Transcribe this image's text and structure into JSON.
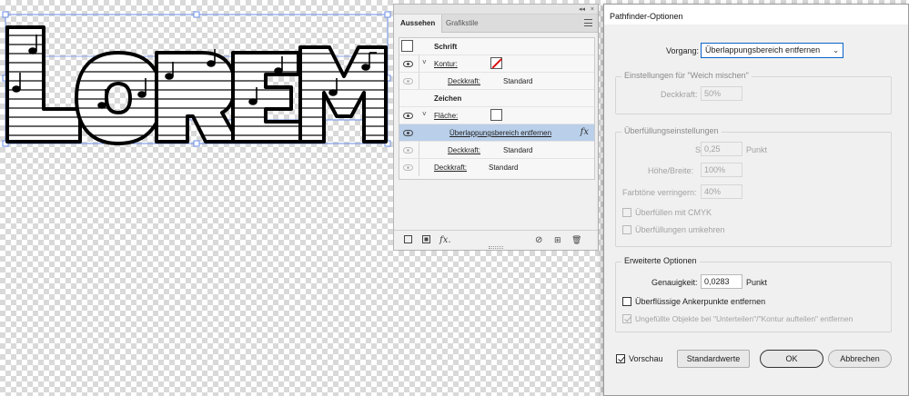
{
  "artwork": {
    "text": "LOREM"
  },
  "appearance_panel": {
    "collapse_icon": "◂◂",
    "close_icon": "×",
    "tabs": [
      {
        "label": "Aussehen",
        "active": true
      },
      {
        "label": "Grafikstile",
        "active": false
      }
    ],
    "rows": [
      {
        "label": "Schrift",
        "type": "header"
      },
      {
        "label": "Kontur:",
        "swatch": "none"
      },
      {
        "label": "Deckkraft:",
        "value": "Standard"
      },
      {
        "label": "Zeichen",
        "type": "header"
      },
      {
        "label": "Fläche:",
        "swatch": "white"
      },
      {
        "label": "Überlappungsbereich entfernen",
        "fx": "fx"
      },
      {
        "label": "Deckkraft:",
        "value": "Standard"
      },
      {
        "label": "Deckkraft:",
        "value": "Standard"
      }
    ],
    "footer_icons": [
      "new-stroke-icon",
      "new-fill-icon",
      "add-effect-icon",
      "clear-appearance-icon",
      "duplicate-item-icon",
      "delete-item-icon"
    ],
    "fx_label": "fx."
  },
  "dialog": {
    "title": "Pathfinder-Optionen",
    "operation_label": "Vorgang:",
    "operation_value": "Überlappungsbereich entfernen",
    "soft_mix": {
      "title": "Einstellungen für \"Weich mischen\"",
      "opacity_label": "Deckkraft:",
      "opacity_value": "50%"
    },
    "trapping": {
      "title": "Überfüllungseinstellungen",
      "strength_label": "Stärke:",
      "strength_value": "0,25",
      "strength_unit": "Punkt",
      "height_width_label": "Höhe/Breite:",
      "height_width_value": "100%",
      "tint_label": "Farbtöne verringern:",
      "tint_value": "40%",
      "cmyk_label": "Überfüllen mit CMYK",
      "reverse_label": "Überfüllungen umkehren"
    },
    "advanced": {
      "title": "Erweiterte Optionen",
      "precision_label": "Genauigkeit:",
      "precision_value": "0,0283",
      "precision_unit": "Punkt",
      "remove_anchor_label": "Überflüssige Ankerpunkte entfernen",
      "remove_anchor_checked": false,
      "unpainted_label": "Ungefüllte Objekte bei \"Unterteilen\"/\"Kontur aufteilen\" entfernen",
      "unpainted_checked": true
    },
    "preview_label": "Vorschau",
    "preview_checked": true,
    "defaults_button": "Standardwerte",
    "ok_button": "OK",
    "cancel_button": "Abbrechen"
  }
}
